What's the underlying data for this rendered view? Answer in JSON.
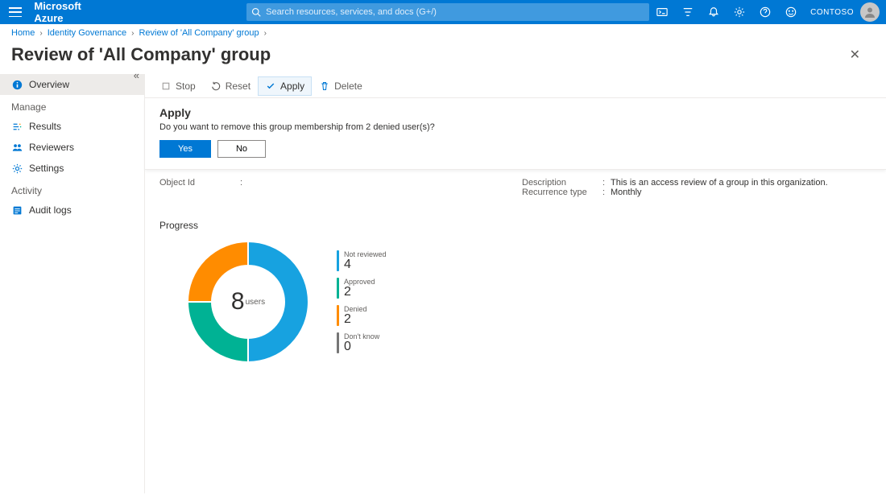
{
  "header": {
    "brand": "Microsoft Azure",
    "search_placeholder": "Search resources, services, and docs (G+/)",
    "tenant": "CONTOSO"
  },
  "breadcrumb": {
    "items": [
      "Home",
      "Identity Governance",
      "Review of 'All Company' group"
    ]
  },
  "page": {
    "title": "Review of 'All Company' group"
  },
  "sidebar": {
    "overview": "Overview",
    "manage_heading": "Manage",
    "results": "Results",
    "reviewers": "Reviewers",
    "settings": "Settings",
    "activity_heading": "Activity",
    "audit_logs": "Audit logs"
  },
  "toolbar": {
    "stop": "Stop",
    "reset": "Reset",
    "apply": "Apply",
    "delete": "Delete"
  },
  "banner": {
    "title": "Apply",
    "message": "Do you want to remove this group membership from 2 denied user(s)?",
    "yes": "Yes",
    "no": "No"
  },
  "details": {
    "object_id_label": "Object Id",
    "object_id_value": "",
    "description_label": "Description",
    "description_value": "This is an access review of a group in this organization.",
    "recurrence_label": "Recurrence type",
    "recurrence_value": "Monthly"
  },
  "progress": {
    "heading": "Progress",
    "total_value": "8",
    "total_label": "users"
  },
  "chart_data": {
    "type": "pie",
    "title": "Progress",
    "total": 8,
    "series": [
      {
        "name": "Not reviewed",
        "value": 4,
        "color": "#17a2e0"
      },
      {
        "name": "Approved",
        "value": 2,
        "color": "#00b294"
      },
      {
        "name": "Denied",
        "value": 2,
        "color": "#ff8c00"
      },
      {
        "name": "Don't know",
        "value": 0,
        "color": "#767676"
      }
    ]
  }
}
